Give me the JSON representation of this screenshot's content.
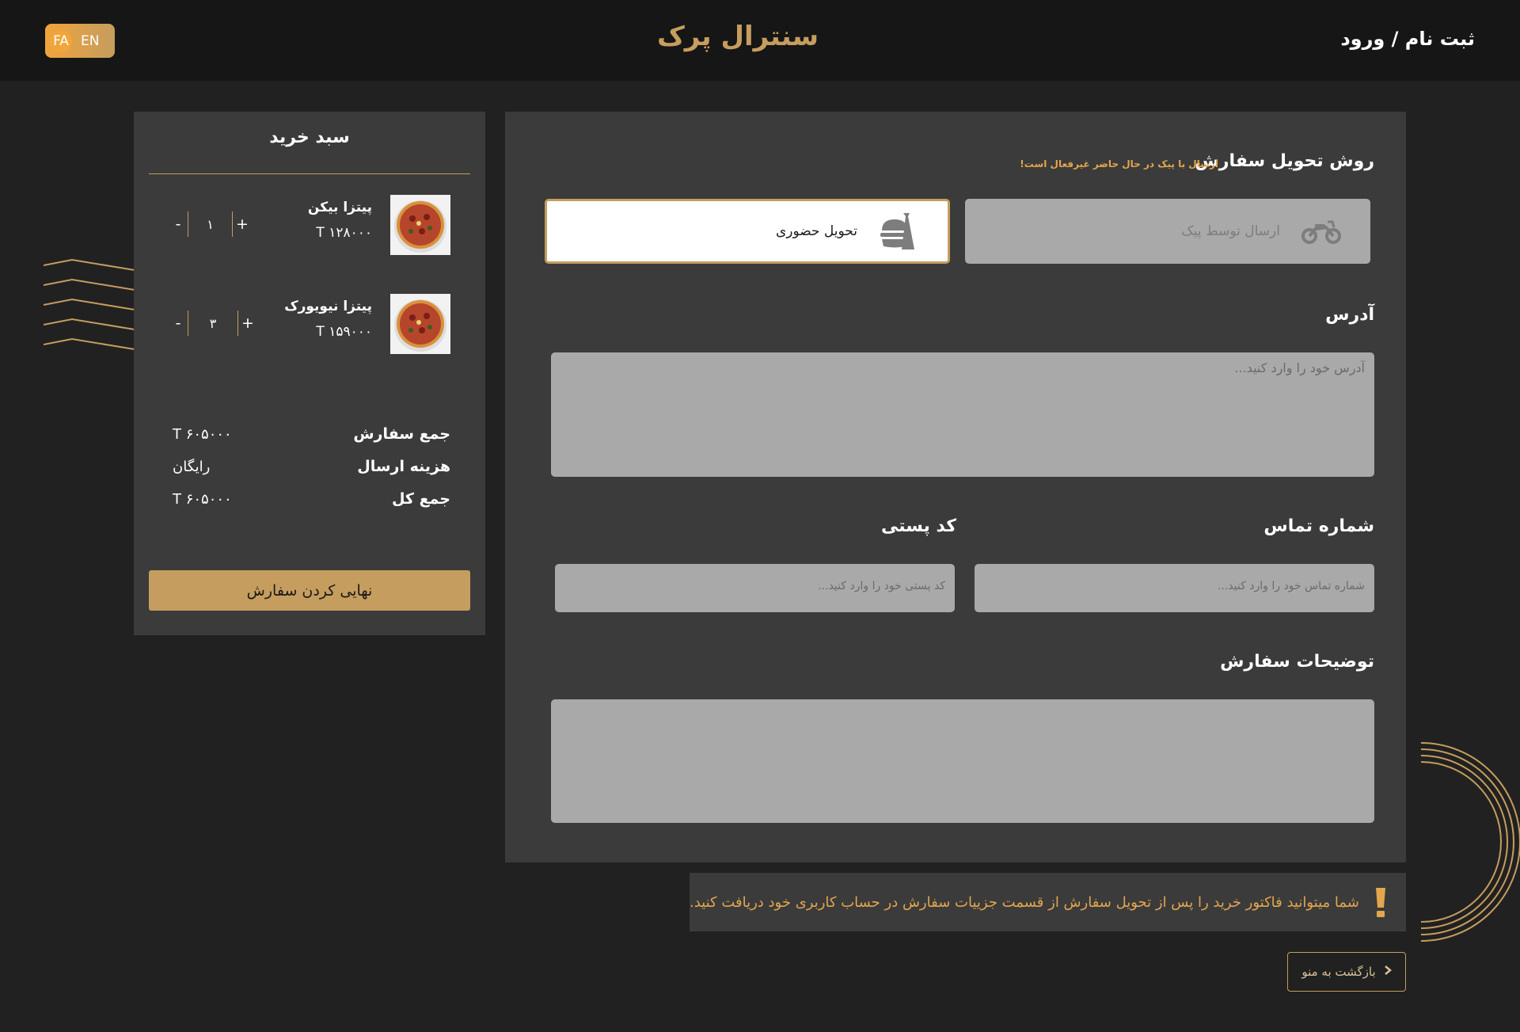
{
  "header": {
    "lang_fa": "FA",
    "lang_en": "EN",
    "brand": "سنترال پرک",
    "auth": "ثبت نام / ورود"
  },
  "cart": {
    "title": "سبد خرید",
    "items": [
      {
        "name": "پیتزا بیکن",
        "price": "T ۱۲۸۰۰۰",
        "qty": "۱",
        "plus": "+",
        "minus": "-"
      },
      {
        "name": "پیتزا نیویورک",
        "price": "T ۱۵۹۰۰۰",
        "qty": "۳",
        "plus": "+",
        "minus": "-"
      }
    ],
    "summary": {
      "subtotal_label": "جمع سفارش",
      "subtotal_value": "T ۶۰۵۰۰۰",
      "shipping_label": "هزینه ارسال",
      "shipping_value": "رایگان",
      "total_label": "جمع کل",
      "total_value": "T ۶۰۵۰۰۰"
    },
    "finalize_label": "نهایی کردن سفارش"
  },
  "form": {
    "delivery_title": "روش تحویل سفارش",
    "delivery_note": "ارسال با پیک در حال حاضر غیرفعال است!",
    "option_courier": "ارسال توسط پیک",
    "option_pickup": "تحویل حضوری",
    "address_title": "آدرس",
    "address_placeholder": "آدرس خود را وارد کنید...",
    "phone_title": "شماره تماس",
    "phone_placeholder": "شماره تماس خود را وارد کنید...",
    "postal_title": "کد پستی",
    "postal_placeholder": "کد پستی خود را وارد کنید...",
    "notes_title": "توضیحات سفارش",
    "notes_placeholder": ""
  },
  "notice": {
    "text": "شما میتوانید فاکتور خرید را پس از تحویل سفارش از قسمت جزییات سفارش در حساب کاربری خود دریافت کنید."
  },
  "back_label": "بازگشت به منو",
  "colors": {
    "background": "#212121",
    "header": "#161616",
    "panel": "#3b3b3b",
    "accent": "#c59d5e",
    "warning": "#e3a64d",
    "input": "#a9a9a9"
  },
  "icons": {
    "courier": "motorcycle-icon",
    "pickup": "takeaway-burger-icon",
    "notice": "exclamation-icon",
    "back": "chevron-right-icon"
  }
}
